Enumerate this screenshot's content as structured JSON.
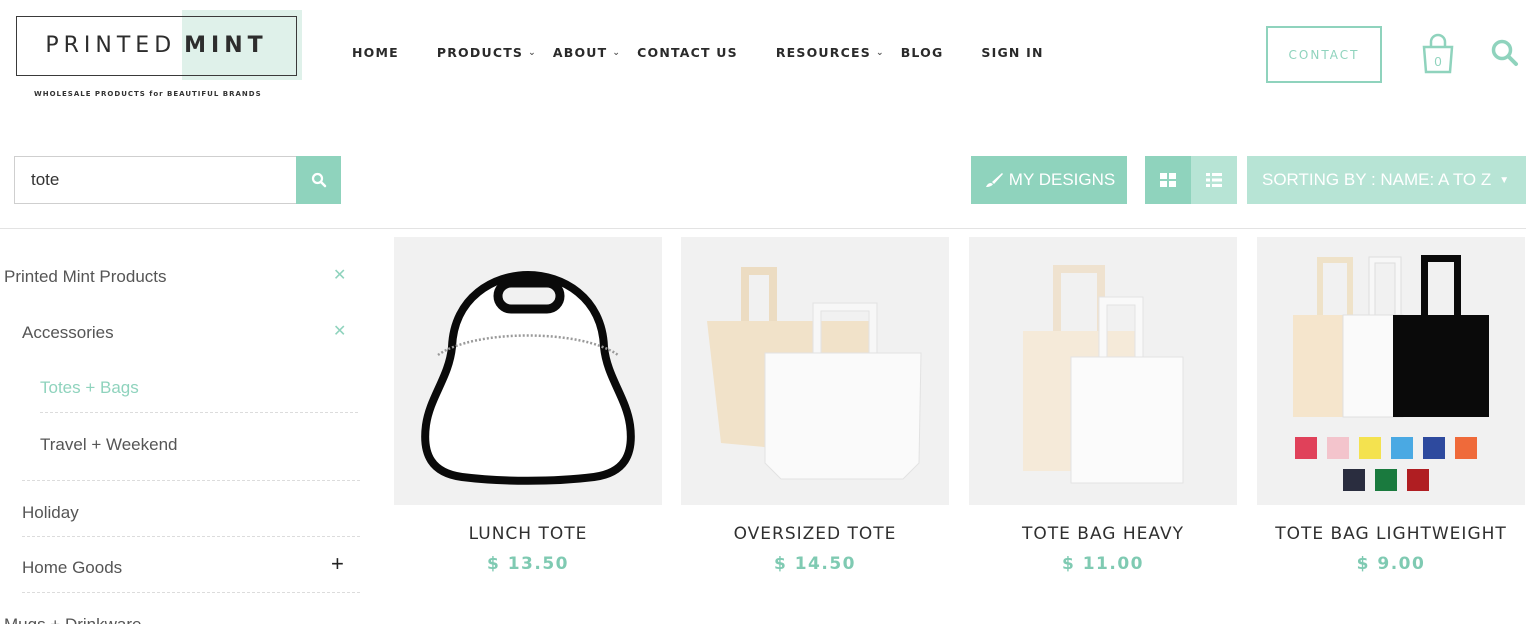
{
  "brand": {
    "name_part1": "PRINTED",
    "name_part2": "MINT",
    "tagline": "WHOLESALE PRODUCTS for BEAUTIFUL BRANDS",
    "accent_color": "#8fd3bd"
  },
  "nav": {
    "items": [
      {
        "label": "HOME",
        "dropdown": false
      },
      {
        "label": "PRODUCTS",
        "dropdown": true
      },
      {
        "label": "ABOUT",
        "dropdown": true
      },
      {
        "label": "CONTACT US",
        "dropdown": false
      },
      {
        "label": "RESOURCES",
        "dropdown": true
      },
      {
        "label": "BLOG",
        "dropdown": false
      },
      {
        "label": "SIGN IN",
        "dropdown": false
      }
    ],
    "contact_button": "CONTACT",
    "cart_count": "0",
    "chevron": "⌄"
  },
  "toolbar": {
    "search_value": "tote",
    "my_designs_label": "MY DESIGNS",
    "sorting_label": "SORTING BY : NAME: A TO Z",
    "caret": "▼"
  },
  "sidebar": {
    "items": [
      {
        "label": "Printed Mint Products",
        "remove": "✕"
      },
      {
        "label": "Accessories",
        "remove": "✕"
      },
      {
        "label": "Totes + Bags"
      },
      {
        "label": "Travel + Weekend"
      },
      {
        "label": "Holiday"
      },
      {
        "label": "Home Goods",
        "expand": "+"
      },
      {
        "label": "Mugs + Drinkware"
      }
    ]
  },
  "products": [
    {
      "name": "LUNCH TOTE",
      "price": "$ 13.50"
    },
    {
      "name": "OVERSIZED TOTE",
      "price": "$ 14.50"
    },
    {
      "name": "TOTE BAG HEAVY",
      "price": "$ 11.00"
    },
    {
      "name": "TOTE BAG LIGHTWEIGHT",
      "price": "$ 9.00"
    }
  ],
  "swatch_colors": [
    "#e0415a",
    "#f3c4cc",
    "#f4e24f",
    "#4aa9e3",
    "#2e4a9e",
    "#ef6a3a",
    "#2a2d3f",
    "#1a7a3e",
    "#b01e22"
  ]
}
